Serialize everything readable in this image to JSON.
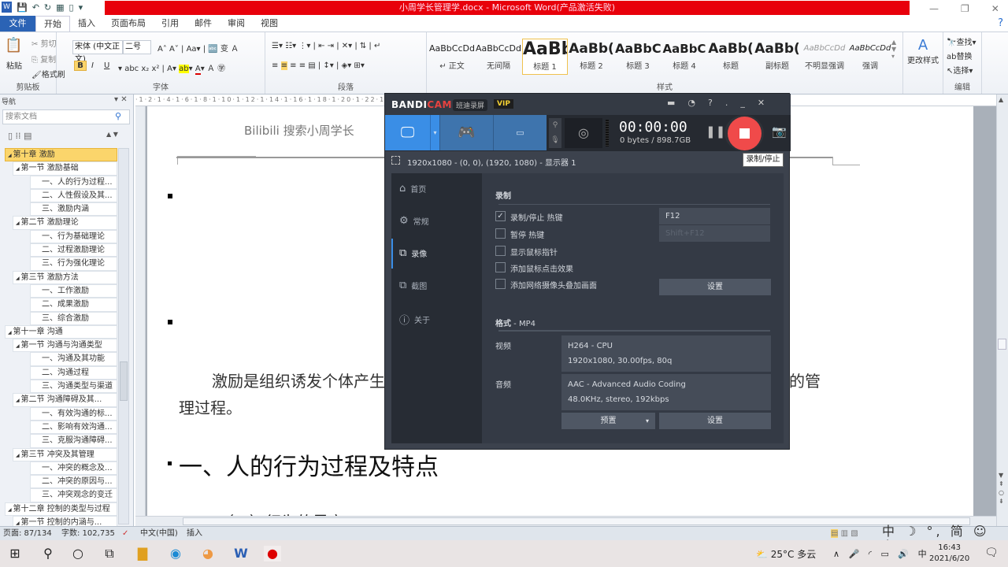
{
  "window": {
    "title": "小周学长管理学.docx - Microsoft Word(产品激活失败)"
  },
  "ribbon_tabs": {
    "file": "文件",
    "tabs": [
      "开始",
      "插入",
      "页面布局",
      "引用",
      "邮件",
      "审阅",
      "视图"
    ]
  },
  "clipboard": {
    "paste": "粘贴",
    "cut": "剪切",
    "copy": "复制",
    "format_painter": "格式刷",
    "label": "剪贴板"
  },
  "font": {
    "name": "宋体 (中文正文)",
    "size": "二号",
    "label": "字体",
    "bold": "B",
    "italic": "I",
    "underline": "U"
  },
  "paragraph": {
    "label": "段落"
  },
  "styles": {
    "label": "样式",
    "items": [
      {
        "preview": "AaBbCcDd",
        "name": "↵ 正文"
      },
      {
        "preview": "AaBbCcDd",
        "name": "无间隔"
      },
      {
        "preview": "AaBb",
        "name": "标题 1"
      },
      {
        "preview": "AaBb(",
        "name": "标题 2"
      },
      {
        "preview": "AaBbC",
        "name": "标题 3"
      },
      {
        "preview": "AaBbC",
        "name": "标题 4"
      },
      {
        "preview": "AaBb(",
        "name": "标题"
      },
      {
        "preview": "AaBb(",
        "name": "副标题"
      },
      {
        "preview": "AaBbCcDd",
        "name": "不明显强调"
      },
      {
        "preview": "AaBbCcDd",
        "name": "强调"
      }
    ],
    "change_styles": "更改样式"
  },
  "editing": {
    "find": "查找",
    "replace": "替换",
    "select": "选择",
    "label": "编辑"
  },
  "nav": {
    "title": "导航",
    "search_placeholder": "搜索文档",
    "items": [
      {
        "level": 0,
        "text": "第十章 激励",
        "selected": true
      },
      {
        "level": 1,
        "text": "第一节 激励基础"
      },
      {
        "level": 2,
        "text": "一、人的行为过程..."
      },
      {
        "level": 2,
        "text": "二、人性假设及其..."
      },
      {
        "level": 2,
        "text": "三、激励内涵"
      },
      {
        "level": 1,
        "text": "第二节 激励理论"
      },
      {
        "level": 2,
        "text": "一、行为基础理论"
      },
      {
        "level": 2,
        "text": "二、过程激励理论"
      },
      {
        "level": 2,
        "text": "三、行为强化理论"
      },
      {
        "level": 1,
        "text": "第三节 激励方法"
      },
      {
        "level": 2,
        "text": "一、工作激励"
      },
      {
        "level": 2,
        "text": "二、成果激励"
      },
      {
        "level": 2,
        "text": "三、综合激励"
      },
      {
        "level": 0,
        "text": "第十一章 沟通"
      },
      {
        "level": 1,
        "text": "第一节 沟通与沟通类型"
      },
      {
        "level": 2,
        "text": "一、沟通及其功能"
      },
      {
        "level": 2,
        "text": "二、沟通过程"
      },
      {
        "level": 2,
        "text": "三、沟通类型与渠道"
      },
      {
        "level": 1,
        "text": "第二节 沟通障碍及其..."
      },
      {
        "level": 2,
        "text": "一、有效沟通的标..."
      },
      {
        "level": 2,
        "text": "二、影响有效沟通..."
      },
      {
        "level": 2,
        "text": "三、克服沟通障碍..."
      },
      {
        "level": 1,
        "text": "第三节 冲突及其管理"
      },
      {
        "level": 2,
        "text": "一、冲突的概念及..."
      },
      {
        "level": 2,
        "text": "二、冲突的原因与..."
      },
      {
        "level": 2,
        "text": "三、冲突观念的变迁"
      },
      {
        "level": 0,
        "text": "第十二章 控制的类型与过程"
      },
      {
        "level": 1,
        "text": "第一节 控制的内涵与..."
      }
    ]
  },
  "document": {
    "header": "Bilibili 搜索小周学长",
    "para_start": "激励是组织诱发个体产生",
    "para_end": "的管",
    "para_line2": "理过程。",
    "heading": "一、人的行为过程及特点",
    "next_line": "（一）行为的界定"
  },
  "status": {
    "page": "页面: 87/134",
    "words": "字数: 102,735",
    "language": "中文(中国)",
    "mode": "插入"
  },
  "ime": {
    "lang": "中",
    "punct": "°,",
    "simp": "简"
  },
  "taskbar": {
    "weather": "25°C 多云",
    "ime": "中",
    "time": "16:43",
    "date": "2021/6/20"
  },
  "bandicam": {
    "brand_a": "BANDI",
    "brand_b": "CAM",
    "brand_cn": "班迪录屏",
    "vip": "VIP",
    "timer": "00:00:00",
    "size": "0 bytes / 898.7GB",
    "region": "1920x1080 - (0, 0), (1920, 1080) - 显示器 1",
    "tooltip": "录制/停止",
    "sidebar": [
      "首页",
      "常规",
      "录像",
      "截图",
      "关于"
    ],
    "active_sidebar": "录像",
    "record_section": "录制",
    "options": [
      {
        "label": "录制/停止 热键",
        "checked": true,
        "hotkey": "F12"
      },
      {
        "label": "暂停 热键",
        "checked": false,
        "hotkey": "Shift+F12"
      },
      {
        "label": "显示鼠标指针",
        "checked": false
      },
      {
        "label": "添加鼠标点击效果",
        "checked": false
      },
      {
        "label": "添加网络摄像头叠加画面",
        "checked": false
      }
    ],
    "settings": "设置",
    "format_label": "格式",
    "format_value": " - MP4",
    "video_label": "视频",
    "video_codec": "H264 - CPU",
    "video_params": "1920x1080, 30.00fps, 80q",
    "audio_label": "音频",
    "audio_codec": "AAC - Advanced Audio Coding",
    "audio_params": "48.0KHz, stereo, 192kbps",
    "preset": "预置",
    "colors": {
      "stop": "#f04a4a",
      "mode_active": "#3a8ee6",
      "brand": "#e8423f"
    }
  }
}
